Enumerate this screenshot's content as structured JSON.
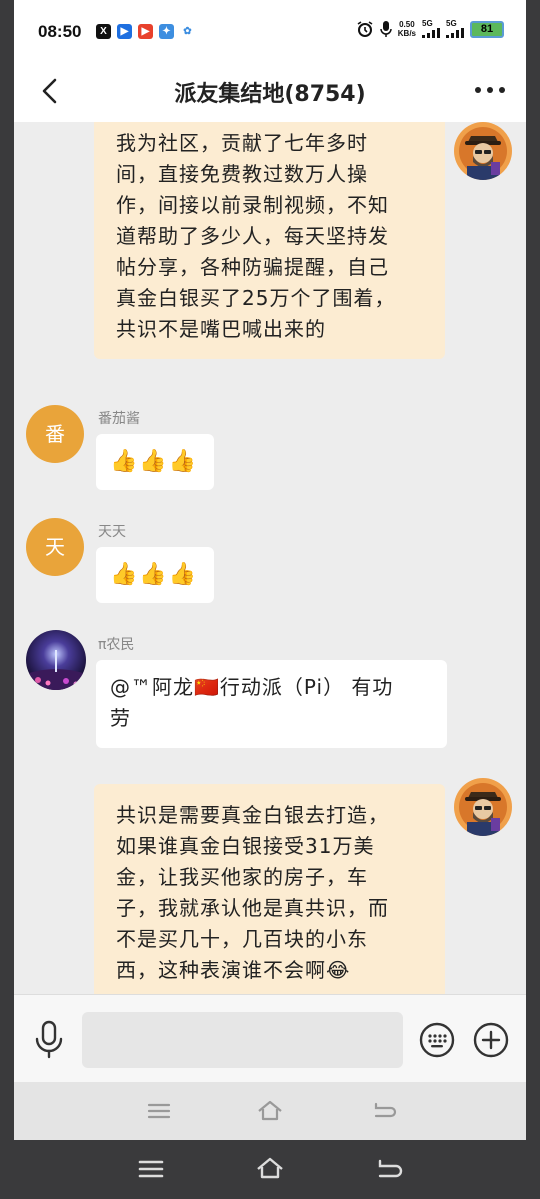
{
  "status_bar": {
    "time": "08:50",
    "apps": [
      {
        "icon": "x-app-icon",
        "label": "X",
        "color": "#111111"
      },
      {
        "icon": "video-app-icon",
        "label": "▶",
        "color": "#1e6fe0"
      },
      {
        "icon": "red-app-icon",
        "label": "▶",
        "color": "#e8412c"
      },
      {
        "icon": "bird-app-icon",
        "label": "✦",
        "color": "#3d8ee0"
      },
      {
        "icon": "baidu-app-icon",
        "label": "✿",
        "color": "#3d8ee0"
      }
    ],
    "speed_value": "0.50",
    "speed_unit": "KB/s",
    "network_1": "5G",
    "network_2": "5G",
    "battery": "81"
  },
  "header": {
    "title": "派友集结地(8754)"
  },
  "messages": [
    {
      "type": "outgoing",
      "text_lines": [
        "我为社区，贡献了七年多时",
        "间，直接免费教过数万人操",
        "作，间接以前录制视频，不知",
        "道帮助了多少人，每天坚持发",
        "帖分享，各种防骗提醒，自己",
        "真金白银买了25万个了围着，",
        "共识不是嘴巴喊出来的"
      ]
    },
    {
      "type": "incoming",
      "sender": "番茄酱",
      "avatar_letter": "番",
      "text": "👍👍👍"
    },
    {
      "type": "incoming",
      "sender": "天天",
      "avatar_letter": "天",
      "text": "👍👍👍"
    },
    {
      "type": "incoming",
      "sender": "π农民",
      "text_lines": [
        "@™阿龙🇨🇳行动派（Pi） 有功",
        "劳"
      ]
    },
    {
      "type": "outgoing",
      "text_lines": [
        "共识是需要真金白银去打造，",
        "如果谁真金白银接受31万美",
        "金，让我买他家的房子，车",
        "子，我就承认他是真共识，而",
        "不是买几十，几百块的小东",
        "西，这种表演谁不会啊😂"
      ]
    }
  ],
  "colors": {
    "outgoing_bubble": "#fcecd2",
    "incoming_bubble": "#ffffff",
    "avatar_orange": "#e9a43a",
    "chat_background": "#ededed"
  }
}
